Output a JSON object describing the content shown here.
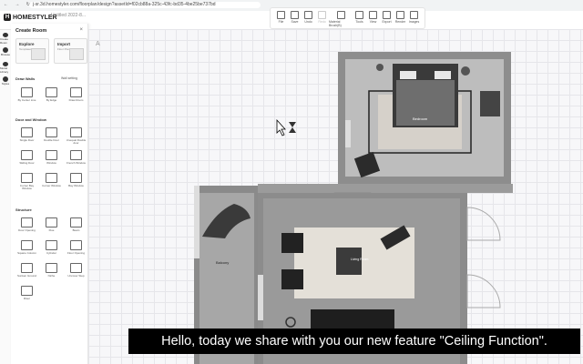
{
  "browser": {
    "nav": "← → ↻",
    "url": "j-sr.3d.homestyler.com/floorplan/design?assetId=f02cb88a-325c-43fc-bd35-4be25be737bd"
  },
  "app": {
    "brand": "HOMESTYLER",
    "project": "Untitled 2022-8..."
  },
  "toolbar": [
    {
      "label": "File",
      "dim": false
    },
    {
      "label": "Save",
      "dim": false
    },
    {
      "label": "Undo",
      "dim": false
    },
    {
      "label": "Redo",
      "dim": true
    },
    {
      "label": "Material Brush(B)",
      "dim": false,
      "wide": true
    },
    {
      "label": "Tools",
      "dim": false
    },
    {
      "label": "View",
      "dim": false
    },
    {
      "label": "Export",
      "dim": false
    },
    {
      "label": "Render",
      "dim": false
    },
    {
      "label": "Images",
      "dim": false
    }
  ],
  "left_rail": [
    "Create Room",
    "Browse",
    "Model Library",
    "Styles"
  ],
  "panel": {
    "title": "Create Room",
    "close": "×",
    "cards": [
      {
        "title": "Explore",
        "sub": "Templates"
      },
      {
        "title": "Import",
        "sub": "Floor Plan"
      }
    ],
    "draw_walls": {
      "title": "Draw Walls",
      "settings": "Wall setting",
      "items": [
        "By Center Line",
        "By Edge",
        "Draw Room"
      ]
    },
    "door_window": {
      "title": "Door and Window",
      "items": [
        "Single Door",
        "Double Door",
        "Unequal Double door",
        "Sliding Door",
        "Window",
        "French Window",
        "Corner Bay Window",
        "Corner Window",
        "Bay Window"
      ]
    },
    "structure": {
      "title": "Structure",
      "items": [
        "Door Opening",
        "Flue",
        "Beam",
        "Square Column",
        "Cylinder",
        "Floor Opening",
        "Sunken Ground",
        "Niche",
        "Uncover Step",
        "Riser"
      ]
    }
  },
  "canvas": {
    "label_left_room": "Balcony",
    "label_rug": "Living Room",
    "label_bed": "Bedroom"
  },
  "caption": "Hello, today we share with you our new feature \"Ceiling Function\"."
}
